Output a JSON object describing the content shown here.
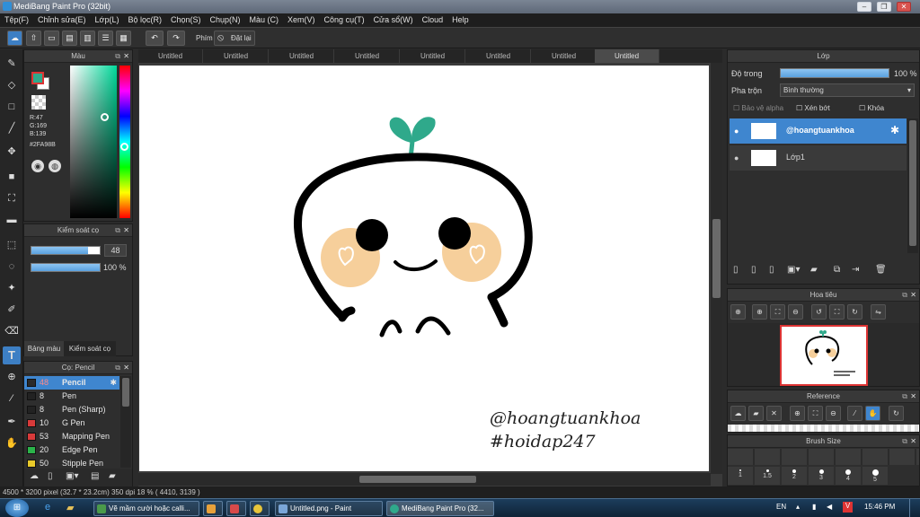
{
  "window": {
    "title": "MediBang Paint Pro (32bit)"
  },
  "menu": [
    "Tệp(F)",
    "Chỉnh sửa(E)",
    "Lớp(L)",
    "Bộ lọc(R)",
    "Chọn(S)",
    "Chụp(N)",
    "Màu (C)",
    "Xem(V)",
    "Công cụ(T)",
    "Cửa sổ(W)",
    "Cloud",
    "Help"
  ],
  "toolbar": {
    "shortcut_label": "Phím",
    "reset_label": "Đặt lại"
  },
  "color_panel": {
    "title": "Màu",
    "r": "R:47",
    "g": "G:169",
    "b": "B:139",
    "hex": "#2FA98B",
    "fg_color": "#2FA98B"
  },
  "brush_control": {
    "title": "Kiểm soát cọ",
    "size": "48",
    "opacity": "100 %",
    "size_fraction": 0.83,
    "opacity_fraction": 1.0
  },
  "left_tabs": {
    "palette": "Bảng màu",
    "brush_control": "Kiểm soát cọ"
  },
  "brush_panel": {
    "title": "Cọ: Pencil",
    "items": [
      {
        "size": "48",
        "name": "Pencil",
        "color": "#2b2b2b",
        "selected": true
      },
      {
        "size": "8",
        "name": "Pen",
        "color": "#222222"
      },
      {
        "size": "8",
        "name": "Pen (Sharp)",
        "color": "#222222"
      },
      {
        "size": "10",
        "name": "G Pen",
        "color": "#d83a3a"
      },
      {
        "size": "53",
        "name": "Mapping Pen",
        "color": "#d83a3a"
      },
      {
        "size": "20",
        "name": "Edge Pen",
        "color": "#2bb34a"
      },
      {
        "size": "50",
        "name": "Stipple Pen",
        "color": "#e8c92a"
      }
    ]
  },
  "tabs": [
    "Untitled",
    "Untitled",
    "Untitled",
    "Untitled",
    "Untitled",
    "Untitled",
    "Untitled",
    "Untitled"
  ],
  "canvas": {
    "watermark_line1": "@hoangtuankhoa",
    "watermark_line2": "#hoidap247"
  },
  "layer_panel": {
    "title": "Lớp",
    "opacity_label": "Độ trong",
    "opacity_value": "100 %",
    "blend_label": "Pha trộn",
    "blend_value": "Bình thường",
    "protect_alpha": "Bảo vệ alpha",
    "clipping": "Xén bớt",
    "lock": "Khóa",
    "layers": [
      {
        "name": "@hoangtuankhoa",
        "selected": true
      },
      {
        "name": "Lớp1",
        "selected": false
      }
    ]
  },
  "navigator": {
    "title": "Hoa tiêu"
  },
  "reference": {
    "title": "Reference"
  },
  "brush_size": {
    "title": "Brush Size",
    "sizes": [
      "1",
      "1.5",
      "2",
      "3",
      "4",
      "5"
    ]
  },
  "status": {
    "text": "4500 * 3200 pixel  (32.7 * 23.2cm)  350 dpi  18 %  ( 4410, 3139 )"
  },
  "taskbar": {
    "items": [
      "Vẽ mầm cười hoặc calli...",
      "",
      "",
      "",
      "Untitled.png - Paint",
      "MediBang Paint Pro (32..."
    ],
    "lang": "EN",
    "time": "15:46 PM"
  },
  "colors": {
    "accent": "#3f86cf",
    "sprout": "#2FA98B",
    "cheek": "#F6CF9B"
  }
}
